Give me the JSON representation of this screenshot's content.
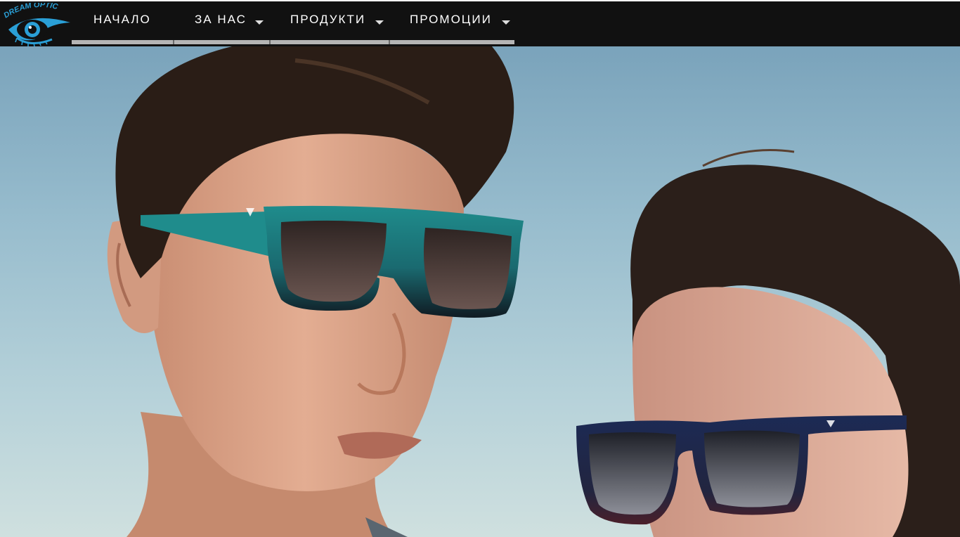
{
  "logo": {
    "text": "DREAM OPTIC",
    "icon": "eye-icon"
  },
  "nav": {
    "items": [
      {
        "label": "НАЧАЛО",
        "has_dropdown": false
      },
      {
        "label": "ЗА НАС",
        "has_dropdown": true
      },
      {
        "label": "ПРОДУКТИ",
        "has_dropdown": true
      },
      {
        "label": "ПРОМОЦИИ",
        "has_dropdown": true
      }
    ]
  },
  "hero": {
    "image": "sunglasses-models-photo"
  },
  "colors": {
    "nav_bg": "#111111",
    "nav_text": "#ffffff",
    "nav_underline": "#b5b5b5",
    "logo_blue": "#2a9fd6",
    "frame_teal": "#1f8c8c",
    "frame_navy": "#1c2a55"
  }
}
